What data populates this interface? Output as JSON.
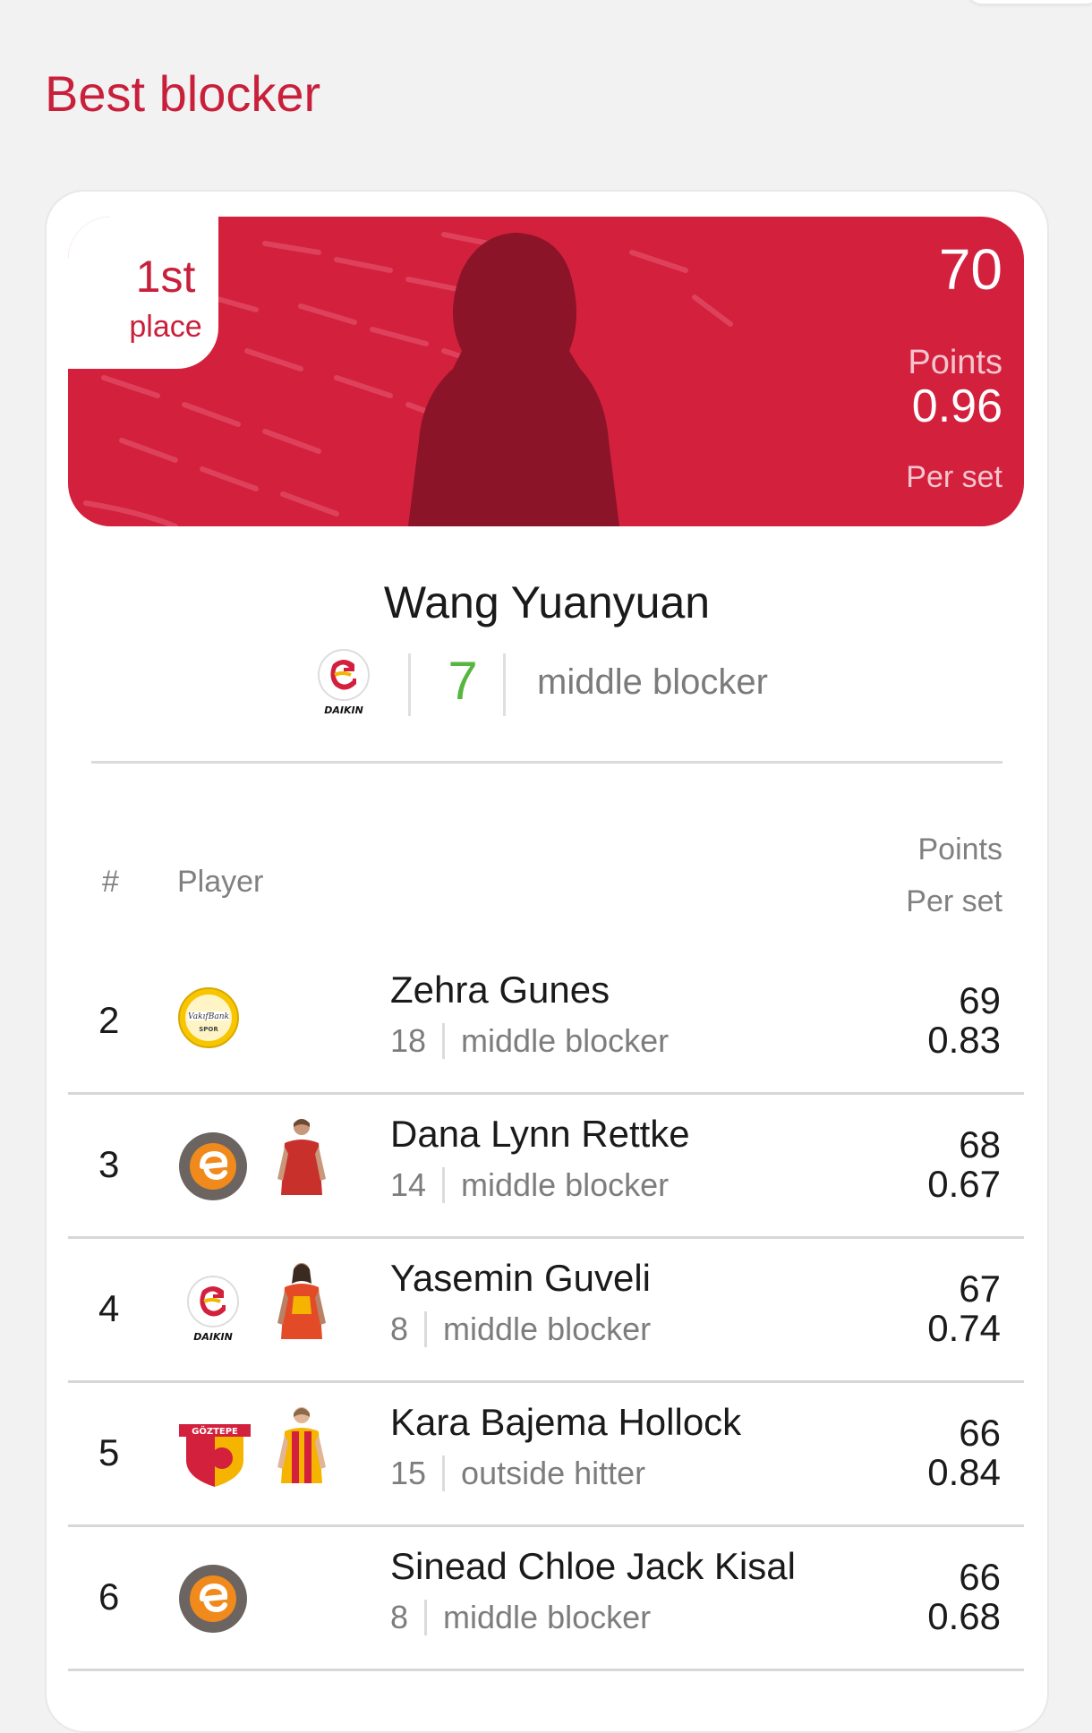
{
  "page": {
    "title": "Best blocker"
  },
  "leader": {
    "rank": "1st",
    "rank_label": "place",
    "points": "70",
    "points_label": "Points",
    "per_set": "0.96",
    "per_set_label": "Per set",
    "name": "Wang Yuanyuan",
    "club_logo": "galatasaray-daikin-logo",
    "number": "7",
    "position": "middle blocker"
  },
  "table": {
    "headers": {
      "rank": "#",
      "player": "Player",
      "points": "Points",
      "per_set": "Per set"
    },
    "rows": [
      {
        "rank": "2",
        "club_logo": "vakifbank-logo",
        "has_photo": false,
        "name": "Zehra Gunes",
        "number": "18",
        "position": "middle blocker",
        "points": "69",
        "per_set": "0.83"
      },
      {
        "rank": "3",
        "club_logo": "eczacibasi-logo",
        "has_photo": true,
        "name": "Dana Lynn Rettke",
        "number": "14",
        "position": "middle blocker",
        "points": "68",
        "per_set": "0.67"
      },
      {
        "rank": "4",
        "club_logo": "galatasaray-daikin-logo",
        "has_photo": true,
        "name": "Yasemin Guveli",
        "number": "8",
        "position": "middle blocker",
        "points": "67",
        "per_set": "0.74"
      },
      {
        "rank": "5",
        "club_logo": "goztepe-logo",
        "has_photo": true,
        "name": "Kara Bajema Hollock",
        "number": "15",
        "position": "outside hitter",
        "points": "66",
        "per_set": "0.84"
      },
      {
        "rank": "6",
        "club_logo": "eczacibasi-logo",
        "has_photo": false,
        "name": "Sinead Chloe Jack Kisal",
        "number": "8",
        "position": "middle blocker",
        "points": "66",
        "per_set": "0.68"
      }
    ]
  },
  "colors": {
    "accent": "#d2203d",
    "number_green": "#58b63f",
    "muted": "#7d7d7d"
  }
}
